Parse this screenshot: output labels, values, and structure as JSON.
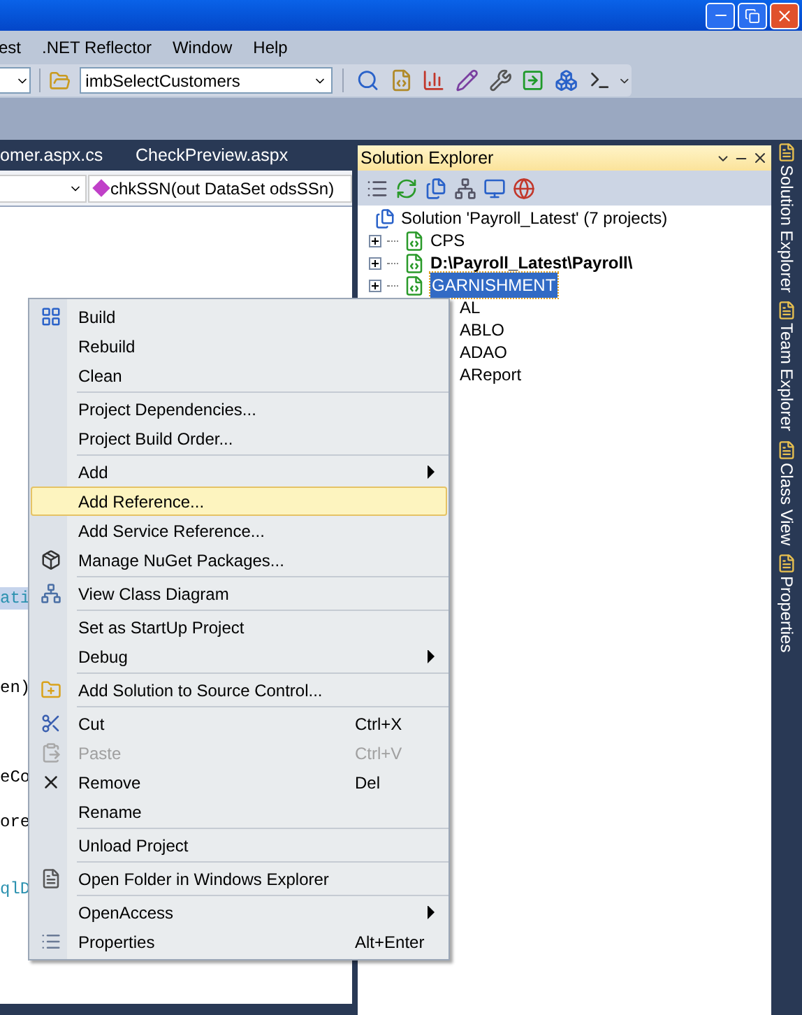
{
  "menu_bar": [
    ".NET Reflector",
    "Window",
    "Help"
  ],
  "menu_bar_cut": "est",
  "toolbar": {
    "target_combo": "imbSelectCustomers"
  },
  "document_tabs": [
    "omer.aspx.cs",
    "CheckPreview.aspx"
  ],
  "editor": {
    "member_combo": "chkSSN(out DataSet odsSSn)",
    "code_fragments": [
      {
        "text": "ati",
        "highlighted": true
      },
      {
        "text": "en)",
        "highlighted": false
      },
      {
        "text": "eCo",
        "highlighted": false
      },
      {
        "text": "ore",
        "highlighted": false
      },
      {
        "text": "qlD",
        "highlighted": false
      }
    ]
  },
  "solution_explorer": {
    "title": "Solution Explorer",
    "solution": "Solution 'Payroll_Latest' (7 projects)",
    "projects": [
      {
        "label": "CPS",
        "expandable": true,
        "bold": false,
        "selected": false
      },
      {
        "label": "D:\\Payroll_Latest\\Payroll\\",
        "expandable": true,
        "bold": true,
        "selected": false
      },
      {
        "label": "GARNISHMENT",
        "expandable": true,
        "bold": false,
        "selected": true
      },
      {
        "label": "AL",
        "expandable": false,
        "bold": false,
        "selected": false
      },
      {
        "label": "ABLO",
        "expandable": false,
        "bold": false,
        "selected": false
      },
      {
        "label": "ADAO",
        "expandable": false,
        "bold": false,
        "selected": false
      },
      {
        "label": "AReport",
        "expandable": false,
        "bold": false,
        "selected": false
      }
    ]
  },
  "side_tabs": [
    "Solution Explorer",
    "Team Explorer",
    "Class View",
    "Properties"
  ],
  "context_menu": [
    [
      {
        "label": "Build",
        "selected": false,
        "disabled": false,
        "submenu": false
      },
      {
        "label": "Rebuild",
        "selected": false,
        "disabled": false,
        "submenu": false
      },
      {
        "label": "Clean",
        "selected": false,
        "disabled": false,
        "submenu": false
      }
    ],
    [
      {
        "label": "Project Dependencies...",
        "selected": false,
        "disabled": false,
        "submenu": false
      },
      {
        "label": "Project Build Order...",
        "selected": false,
        "disabled": false,
        "submenu": false
      }
    ],
    [
      {
        "label": "Add",
        "selected": false,
        "disabled": false,
        "submenu": true
      },
      {
        "label": "Add Reference...",
        "selected": true,
        "disabled": false,
        "submenu": false
      },
      {
        "label": "Add Service Reference...",
        "selected": false,
        "disabled": false,
        "submenu": false
      },
      {
        "label": "Manage NuGet Packages...",
        "selected": false,
        "disabled": false,
        "submenu": false
      }
    ],
    [
      {
        "label": "View Class Diagram",
        "selected": false,
        "disabled": false,
        "submenu": false
      }
    ],
    [
      {
        "label": "Set as StartUp Project",
        "selected": false,
        "disabled": false,
        "submenu": false
      },
      {
        "label": "Debug",
        "selected": false,
        "disabled": false,
        "submenu": true
      }
    ],
    [
      {
        "label": "Add Solution to Source Control...",
        "selected": false,
        "disabled": false,
        "submenu": false
      }
    ],
    [
      {
        "label": "Cut",
        "shortcut": "Ctrl+X",
        "selected": false,
        "disabled": false,
        "submenu": false
      },
      {
        "label": "Paste",
        "shortcut": "Ctrl+V",
        "selected": false,
        "disabled": true,
        "submenu": false
      },
      {
        "label": "Remove",
        "shortcut": "Del",
        "selected": false,
        "disabled": false,
        "submenu": false
      },
      {
        "label": "Rename",
        "selected": false,
        "disabled": false,
        "submenu": false
      }
    ],
    [
      {
        "label": "Unload Project",
        "selected": false,
        "disabled": false,
        "submenu": false
      }
    ],
    [
      {
        "label": "Open Folder in Windows Explorer",
        "selected": false,
        "disabled": false,
        "submenu": false
      }
    ],
    [
      {
        "label": "OpenAccess",
        "selected": false,
        "disabled": false,
        "submenu": true
      },
      {
        "label": "Properties",
        "shortcut": "Alt+Enter",
        "selected": false,
        "disabled": false,
        "submenu": false
      }
    ]
  ]
}
